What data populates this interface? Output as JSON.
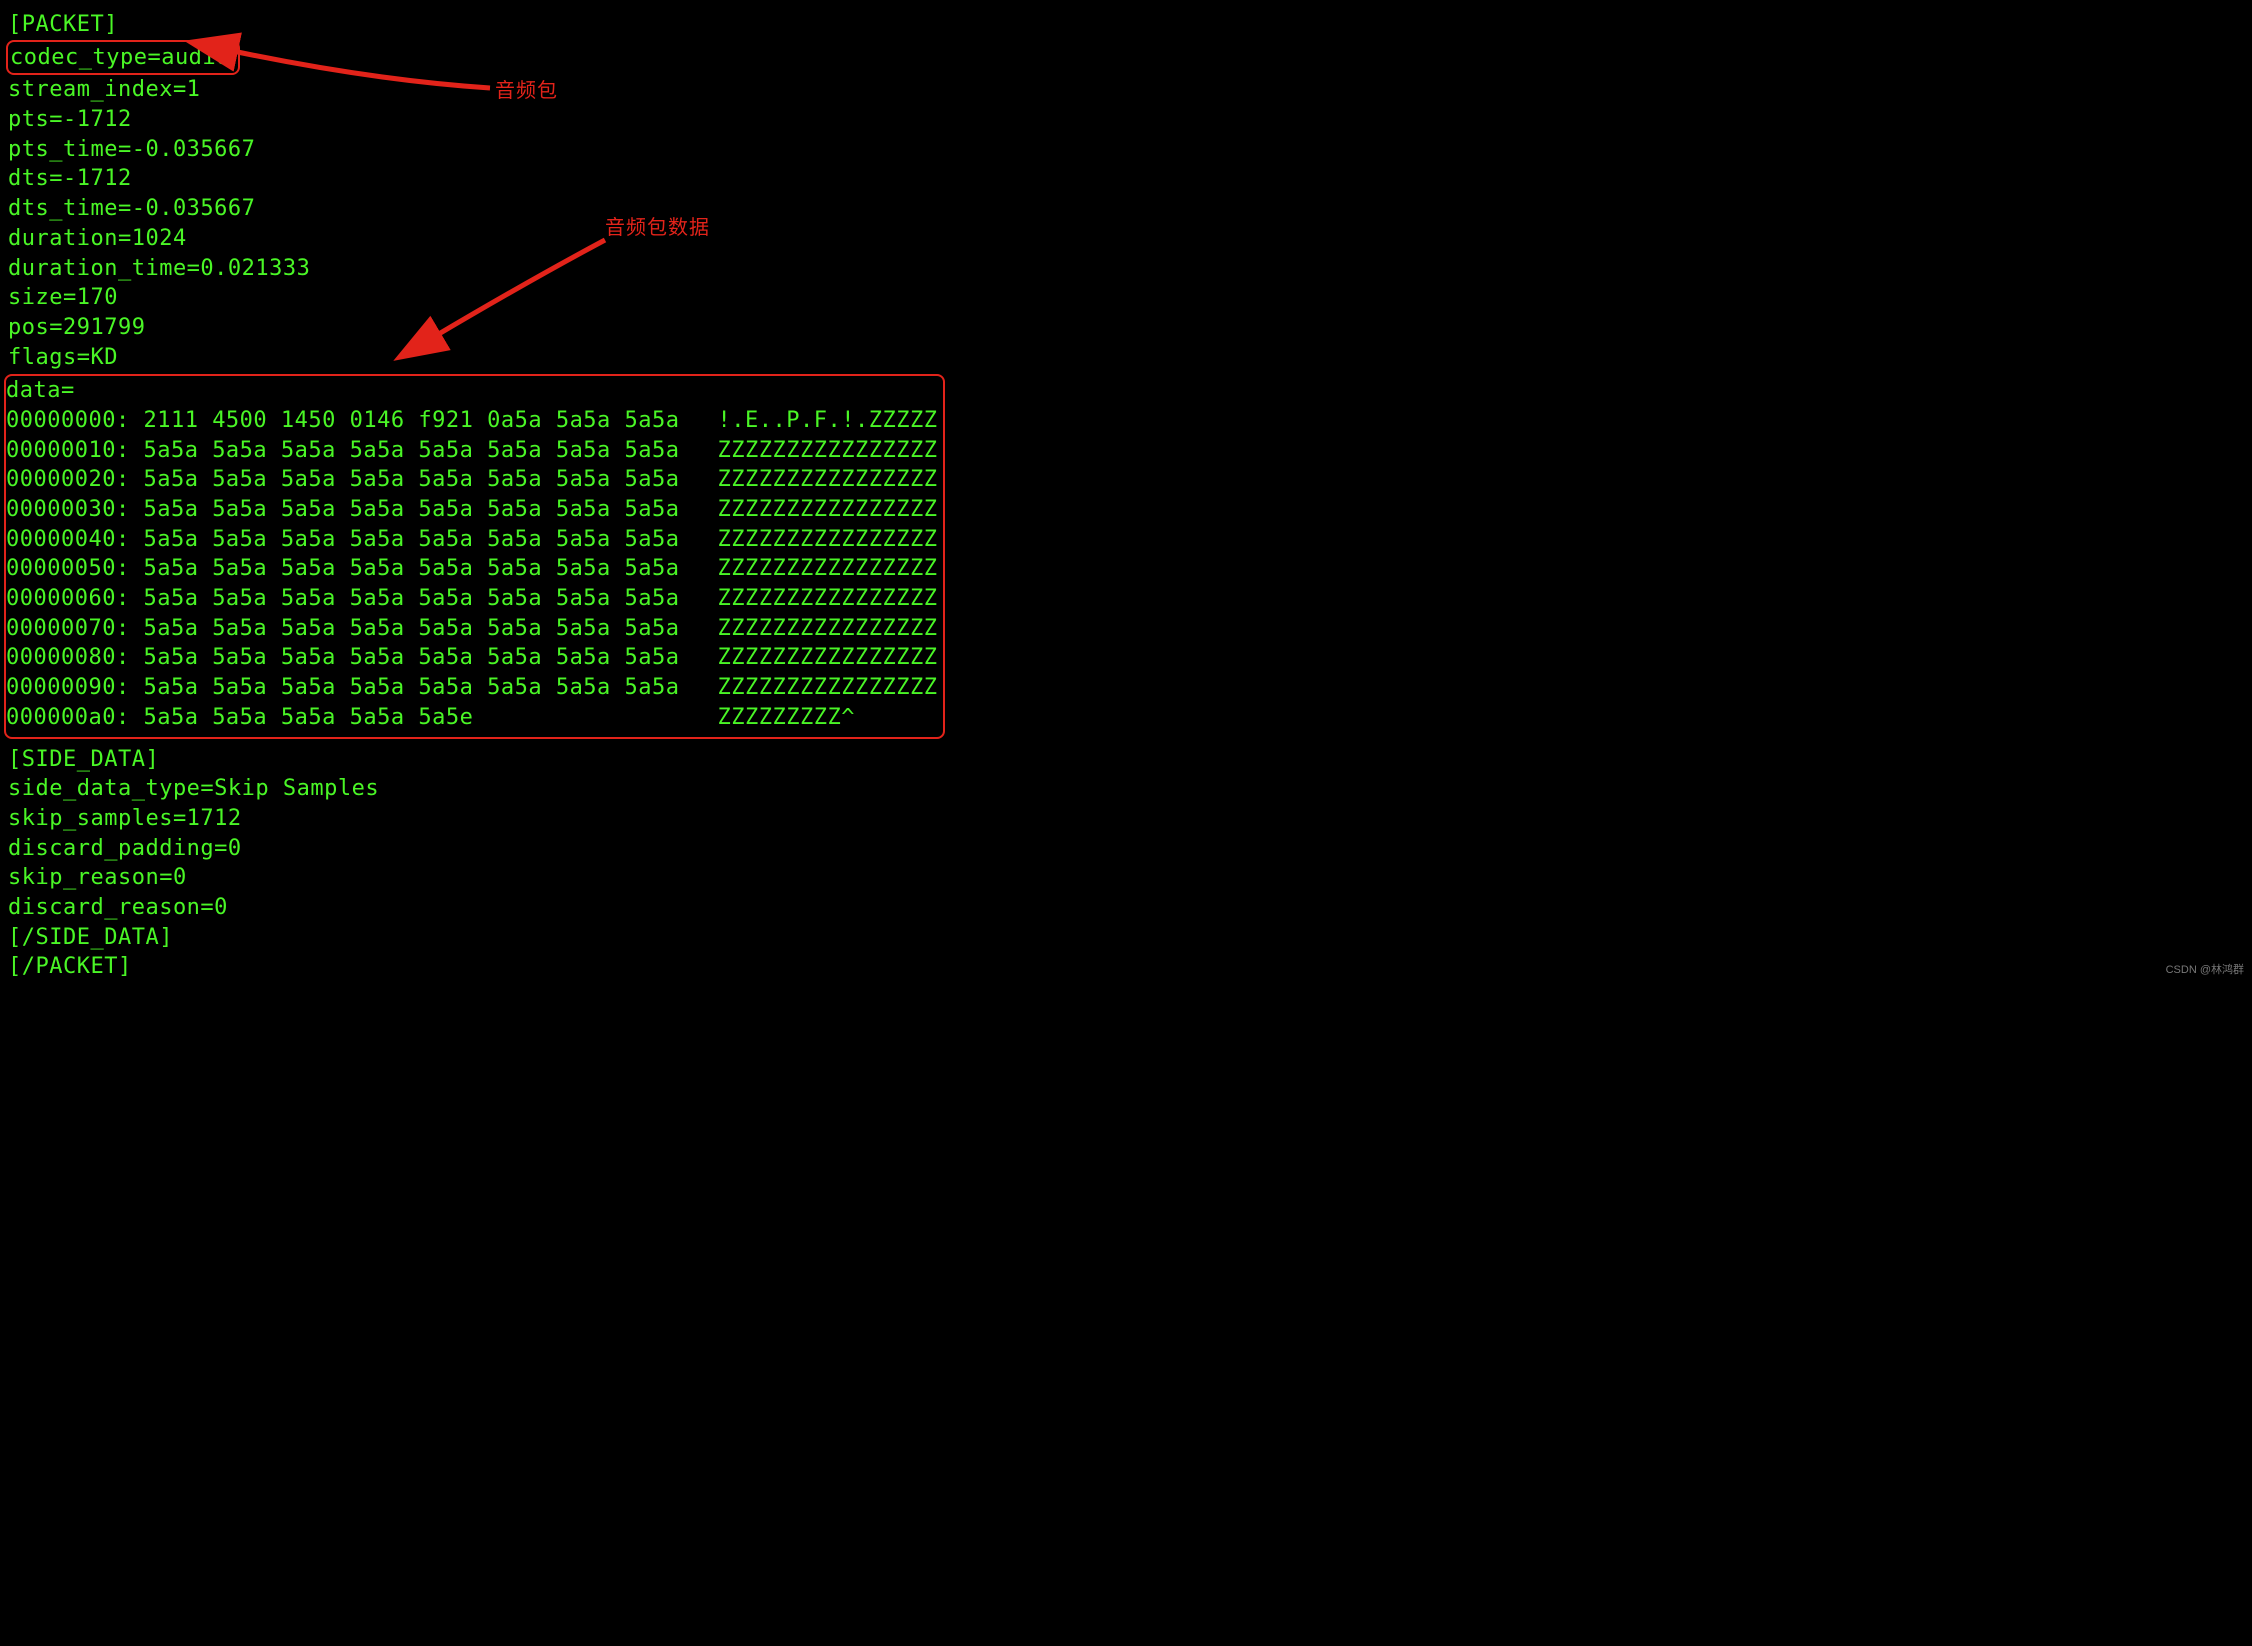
{
  "packet": {
    "header": "[PACKET]",
    "codec_type": "codec_type=audio",
    "stream_index": "stream_index=1",
    "pts": "pts=-1712",
    "pts_time": "pts_time=-0.035667",
    "dts": "dts=-1712",
    "dts_time": "dts_time=-0.035667",
    "duration": "duration=1024",
    "duration_time": "duration_time=0.021333",
    "size": "size=170",
    "pos": "pos=291799",
    "flags": "flags=KD",
    "data_label": "data=",
    "footer": "[/PACKET]"
  },
  "hex": [
    {
      "off": "00000000:",
      "b": " 2111 4500 1450 0146 f921 0a5a 5a5a 5a5a",
      "a": "!.E..P.F.!.ZZZZZ"
    },
    {
      "off": "00000010:",
      "b": " 5a5a 5a5a 5a5a 5a5a 5a5a 5a5a 5a5a 5a5a",
      "a": "ZZZZZZZZZZZZZZZZ"
    },
    {
      "off": "00000020:",
      "b": " 5a5a 5a5a 5a5a 5a5a 5a5a 5a5a 5a5a 5a5a",
      "a": "ZZZZZZZZZZZZZZZZ"
    },
    {
      "off": "00000030:",
      "b": " 5a5a 5a5a 5a5a 5a5a 5a5a 5a5a 5a5a 5a5a",
      "a": "ZZZZZZZZZZZZZZZZ"
    },
    {
      "off": "00000040:",
      "b": " 5a5a 5a5a 5a5a 5a5a 5a5a 5a5a 5a5a 5a5a",
      "a": "ZZZZZZZZZZZZZZZZ"
    },
    {
      "off": "00000050:",
      "b": " 5a5a 5a5a 5a5a 5a5a 5a5a 5a5a 5a5a 5a5a",
      "a": "ZZZZZZZZZZZZZZZZ"
    },
    {
      "off": "00000060:",
      "b": " 5a5a 5a5a 5a5a 5a5a 5a5a 5a5a 5a5a 5a5a",
      "a": "ZZZZZZZZZZZZZZZZ"
    },
    {
      "off": "00000070:",
      "b": " 5a5a 5a5a 5a5a 5a5a 5a5a 5a5a 5a5a 5a5a",
      "a": "ZZZZZZZZZZZZZZZZ"
    },
    {
      "off": "00000080:",
      "b": " 5a5a 5a5a 5a5a 5a5a 5a5a 5a5a 5a5a 5a5a",
      "a": "ZZZZZZZZZZZZZZZZ"
    },
    {
      "off": "00000090:",
      "b": " 5a5a 5a5a 5a5a 5a5a 5a5a 5a5a 5a5a 5a5a",
      "a": "ZZZZZZZZZZZZZZZZ"
    },
    {
      "off": "000000a0:",
      "b": " 5a5a 5a5a 5a5a 5a5a 5a5e",
      "a": "ZZZZZZZZZ^"
    }
  ],
  "side_data": {
    "header": "[SIDE_DATA]",
    "type": "side_data_type=Skip Samples",
    "skip_samples": "skip_samples=1712",
    "discard_padding": "discard_padding=0",
    "skip_reason": "skip_reason=0",
    "discard_reason": "discard_reason=0",
    "footer": "[/SIDE_DATA]"
  },
  "annotations": {
    "label1": "音频包",
    "label2": "音频包数据"
  },
  "watermark": "CSDN @林鸿群",
  "colors": {
    "terminal_foreground": "#4af626",
    "terminal_background": "#000000",
    "annotation_red": "#e2231a"
  }
}
